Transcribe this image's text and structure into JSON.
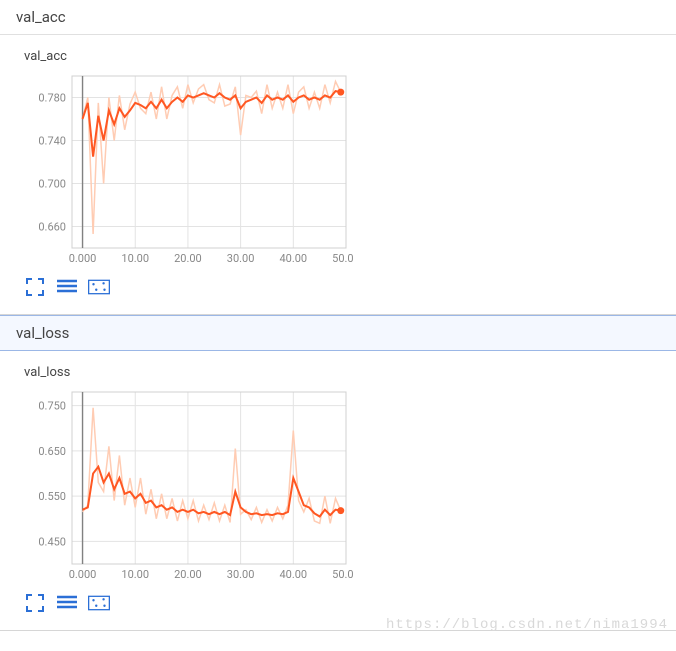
{
  "panels": [
    {
      "header": "val_acc",
      "chart_title": "val_acc",
      "chart_key": "val_acc",
      "header_style": "plain"
    },
    {
      "header": "val_loss",
      "chart_title": "val_loss",
      "chart_key": "val_loss",
      "header_style": "blue"
    }
  ],
  "toolbar": {
    "fullscreen_tip": "Toggle fullscreen",
    "list_tip": "Toggle list",
    "dots_tip": "Toggle points"
  },
  "watermark": "https://blog.csdn.net/nima1994",
  "chart_data": [
    {
      "key": "val_acc",
      "type": "line",
      "title": "val_acc",
      "xlabel": "",
      "ylabel": "",
      "xlim": [
        -2,
        50
      ],
      "ylim": [
        0.64,
        0.8
      ],
      "x_ticks": [
        0.0,
        10.0,
        20.0,
        30.0,
        40.0,
        50.0
      ],
      "y_ticks": [
        0.66,
        0.7,
        0.74,
        0.78
      ],
      "series": [
        {
          "name": "val_acc_smoothed",
          "style": "main",
          "x": [
            0,
            1,
            2,
            3,
            4,
            5,
            6,
            7,
            8,
            9,
            10,
            11,
            12,
            13,
            14,
            15,
            16,
            17,
            18,
            19,
            20,
            21,
            22,
            23,
            24,
            25,
            26,
            27,
            28,
            29,
            30,
            31,
            32,
            33,
            34,
            35,
            36,
            37,
            38,
            39,
            40,
            41,
            42,
            43,
            44,
            45,
            46,
            47,
            48,
            49
          ],
          "values": [
            0.76,
            0.775,
            0.725,
            0.763,
            0.74,
            0.768,
            0.755,
            0.77,
            0.762,
            0.768,
            0.775,
            0.773,
            0.77,
            0.776,
            0.77,
            0.778,
            0.77,
            0.776,
            0.78,
            0.776,
            0.782,
            0.78,
            0.782,
            0.784,
            0.782,
            0.78,
            0.784,
            0.78,
            0.778,
            0.782,
            0.77,
            0.776,
            0.778,
            0.78,
            0.775,
            0.782,
            0.778,
            0.78,
            0.778,
            0.782,
            0.776,
            0.78,
            0.782,
            0.778,
            0.78,
            0.778,
            0.782,
            0.78,
            0.786,
            0.785
          ]
        },
        {
          "name": "val_acc_raw",
          "style": "ghost",
          "x": [
            0,
            1,
            2,
            3,
            4,
            5,
            6,
            7,
            8,
            9,
            10,
            11,
            12,
            13,
            14,
            15,
            16,
            17,
            18,
            19,
            20,
            21,
            22,
            23,
            24,
            25,
            26,
            27,
            28,
            29,
            30,
            31,
            32,
            33,
            34,
            35,
            36,
            37,
            38,
            39,
            40,
            41,
            42,
            43,
            44,
            45,
            46,
            47,
            48,
            49
          ],
          "values": [
            0.76,
            0.78,
            0.653,
            0.775,
            0.7,
            0.78,
            0.74,
            0.782,
            0.75,
            0.774,
            0.785,
            0.77,
            0.765,
            0.785,
            0.76,
            0.79,
            0.76,
            0.782,
            0.79,
            0.77,
            0.792,
            0.775,
            0.788,
            0.792,
            0.778,
            0.775,
            0.792,
            0.772,
            0.774,
            0.79,
            0.745,
            0.782,
            0.78,
            0.786,
            0.765,
            0.792,
            0.77,
            0.785,
            0.77,
            0.792,
            0.765,
            0.785,
            0.79,
            0.77,
            0.785,
            0.77,
            0.792,
            0.775,
            0.795,
            0.785
          ]
        }
      ]
    },
    {
      "key": "val_loss",
      "type": "line",
      "title": "val_loss",
      "xlabel": "",
      "ylabel": "",
      "xlim": [
        -2,
        50
      ],
      "ylim": [
        0.4,
        0.78
      ],
      "x_ticks": [
        0.0,
        10.0,
        20.0,
        30.0,
        40.0,
        50.0
      ],
      "y_ticks": [
        0.45,
        0.55,
        0.65,
        0.75
      ],
      "series": [
        {
          "name": "val_loss_smoothed",
          "style": "main",
          "x": [
            0,
            1,
            2,
            3,
            4,
            5,
            6,
            7,
            8,
            9,
            10,
            11,
            12,
            13,
            14,
            15,
            16,
            17,
            18,
            19,
            20,
            21,
            22,
            23,
            24,
            25,
            26,
            27,
            28,
            29,
            30,
            31,
            32,
            33,
            34,
            35,
            36,
            37,
            38,
            39,
            40,
            41,
            42,
            43,
            44,
            45,
            46,
            47,
            48,
            49
          ],
          "values": [
            0.52,
            0.525,
            0.6,
            0.615,
            0.58,
            0.6,
            0.565,
            0.59,
            0.555,
            0.56,
            0.545,
            0.555,
            0.535,
            0.54,
            0.525,
            0.53,
            0.52,
            0.525,
            0.515,
            0.52,
            0.515,
            0.52,
            0.512,
            0.515,
            0.51,
            0.515,
            0.51,
            0.515,
            0.508,
            0.56,
            0.525,
            0.515,
            0.51,
            0.512,
            0.508,
            0.51,
            0.508,
            0.512,
            0.51,
            0.515,
            0.59,
            0.56,
            0.53,
            0.525,
            0.512,
            0.505,
            0.52,
            0.508,
            0.52,
            0.518
          ]
        },
        {
          "name": "val_loss_raw",
          "style": "ghost",
          "x": [
            0,
            1,
            2,
            3,
            4,
            5,
            6,
            7,
            8,
            9,
            10,
            11,
            12,
            13,
            14,
            15,
            16,
            17,
            18,
            19,
            20,
            21,
            22,
            23,
            24,
            25,
            26,
            27,
            28,
            29,
            30,
            31,
            32,
            33,
            34,
            35,
            36,
            37,
            38,
            39,
            40,
            41,
            42,
            43,
            44,
            45,
            46,
            47,
            48,
            49
          ],
          "values": [
            0.515,
            0.53,
            0.745,
            0.58,
            0.56,
            0.66,
            0.54,
            0.64,
            0.53,
            0.59,
            0.525,
            0.59,
            0.51,
            0.565,
            0.5,
            0.555,
            0.5,
            0.545,
            0.495,
            0.54,
            0.5,
            0.54,
            0.495,
            0.53,
            0.498,
            0.535,
            0.495,
            0.53,
            0.492,
            0.655,
            0.51,
            0.52,
            0.498,
            0.525,
            0.492,
            0.52,
            0.495,
            0.525,
            0.5,
            0.53,
            0.695,
            0.54,
            0.515,
            0.545,
            0.495,
            0.49,
            0.55,
            0.49,
            0.545,
            0.518
          ]
        }
      ]
    }
  ]
}
